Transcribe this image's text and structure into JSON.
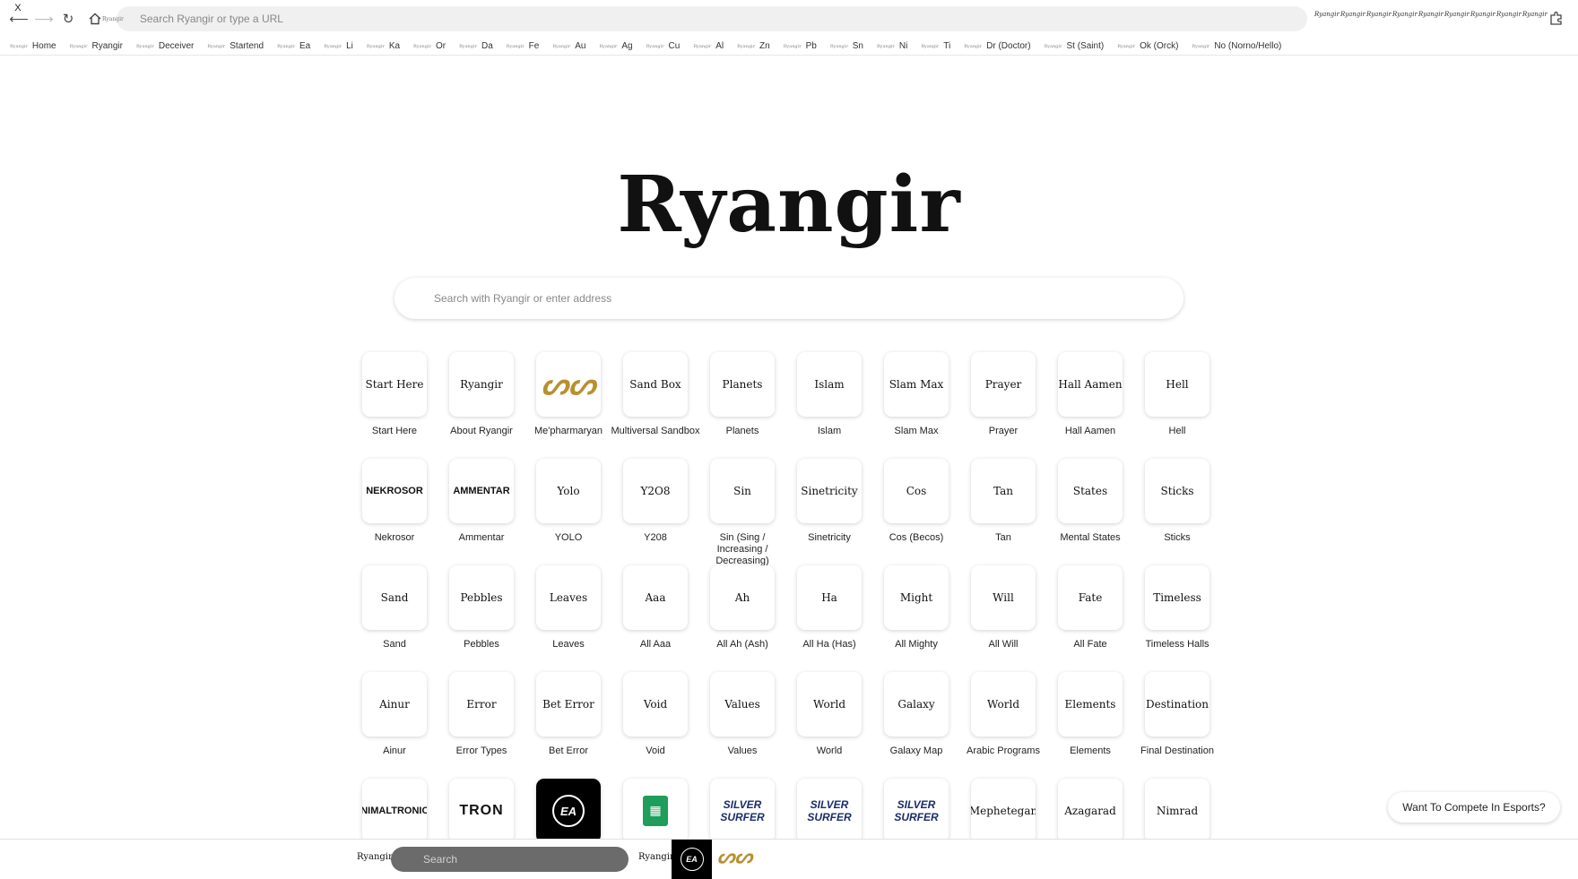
{
  "toolbar": {
    "close_label": "X",
    "back_icon": "back-arrow-icon",
    "forward_icon": "forward-arrow-icon",
    "reload_icon": "reload-icon",
    "home_icon": "home-icon",
    "address_placeholder": "Search Ryangir or type a URL",
    "address_favicon": "Ryangir",
    "extensions": [
      "Ryangir",
      "Ryangir",
      "Ryangir",
      "Ryangir",
      "Ryangir",
      "Ryangir",
      "Ryangir",
      "Ryangir",
      "Ryangir"
    ]
  },
  "bookmarks": [
    "Home",
    "Ryangir",
    "Deceiver",
    "Startend",
    "Ea",
    "Li",
    "Ka",
    "Or",
    "Da",
    "Fe",
    "Au",
    "Ag",
    "Cu",
    "Al",
    "Zn",
    "Pb",
    "Sn",
    "Ni",
    "Ti",
    "Dr (Doctor)",
    "St (Saint)",
    "Ok (Orck)",
    "No (Norno/Hello)"
  ],
  "bookmark_favicon": "Ryangir",
  "logo": {
    "text": "Ryangir"
  },
  "search": {
    "placeholder": "Search with Ryangir or enter address"
  },
  "tiles": [
    {
      "icon": "Start Here",
      "label": "Start Here",
      "style": ""
    },
    {
      "icon": "Ryangir",
      "label": "About Ryangir",
      "style": ""
    },
    {
      "icon": "ᔕᔕ",
      "label": "Me'pharmaryan",
      "style": "gold"
    },
    {
      "icon": "Sand Box",
      "label": "Multiversal Sandbox",
      "style": ""
    },
    {
      "icon": "Planets",
      "label": "Planets",
      "style": ""
    },
    {
      "icon": "Islam",
      "label": "Islam",
      "style": ""
    },
    {
      "icon": "Slam Max",
      "label": "Slam Max",
      "style": ""
    },
    {
      "icon": "Prayer",
      "label": "Prayer",
      "style": ""
    },
    {
      "icon": "Hall Aamen",
      "label": "Hall Aamen",
      "style": ""
    },
    {
      "icon": "Hell",
      "label": "Hell",
      "style": ""
    },
    {
      "icon": "NEKROSOR",
      "label": "Nekrosor",
      "style": "bold"
    },
    {
      "icon": "AMMENTAR",
      "label": "Ammentar",
      "style": "bold"
    },
    {
      "icon": "Yolo",
      "label": "YOLO",
      "style": ""
    },
    {
      "icon": "Y2O8",
      "label": "Y208",
      "style": ""
    },
    {
      "icon": "Sin",
      "label": "Sin (Sing / Increasing / Decreasing)",
      "style": ""
    },
    {
      "icon": "Sinetricity",
      "label": "Sinetricity",
      "style": ""
    },
    {
      "icon": "Cos",
      "label": "Cos (Becos)",
      "style": ""
    },
    {
      "icon": "Tan",
      "label": "Tan",
      "style": ""
    },
    {
      "icon": "States",
      "label": "Mental States",
      "style": ""
    },
    {
      "icon": "Sticks",
      "label": "Sticks",
      "style": ""
    },
    {
      "icon": "Sand",
      "label": "Sand",
      "style": ""
    },
    {
      "icon": "Pebbles",
      "label": "Pebbles",
      "style": ""
    },
    {
      "icon": "Leaves",
      "label": "Leaves",
      "style": ""
    },
    {
      "icon": "Aaa",
      "label": "All Aaa",
      "style": ""
    },
    {
      "icon": "Ah",
      "label": "All Ah (Ash)",
      "style": ""
    },
    {
      "icon": "Ha",
      "label": "All Ha (Has)",
      "style": ""
    },
    {
      "icon": "Might",
      "label": "All Mighty",
      "style": ""
    },
    {
      "icon": "Will",
      "label": "All Will",
      "style": ""
    },
    {
      "icon": "Fate",
      "label": "All Fate",
      "style": ""
    },
    {
      "icon": "Timeless",
      "label": "Timeless Halls",
      "style": ""
    },
    {
      "icon": "Ainur",
      "label": "Ainur",
      "style": ""
    },
    {
      "icon": "Error",
      "label": "Error Types",
      "style": ""
    },
    {
      "icon": "Bet Error",
      "label": "Bet Error",
      "style": ""
    },
    {
      "icon": "Void",
      "label": "Void",
      "style": ""
    },
    {
      "icon": "Values",
      "label": "Values",
      "style": ""
    },
    {
      "icon": "World",
      "label": "World",
      "style": ""
    },
    {
      "icon": "Galaxy",
      "label": "Galaxy Map",
      "style": ""
    },
    {
      "icon": "World",
      "label": "Arabic Programs",
      "style": ""
    },
    {
      "icon": "Elements",
      "label": "Elements",
      "style": ""
    },
    {
      "icon": "Destination",
      "label": "Final Destination",
      "style": ""
    },
    {
      "icon": "ANIMALTRONICS",
      "label": "",
      "style": "bold"
    },
    {
      "icon": "TRON",
      "label": "",
      "style": "tron"
    },
    {
      "icon": "EA",
      "label": "",
      "style": "black"
    },
    {
      "icon": "▦",
      "label": "",
      "style": "sheets"
    },
    {
      "icon": "SILVER SURFER",
      "label": "",
      "style": "surfer"
    },
    {
      "icon": "SILVER SURFER",
      "label": "",
      "style": "surfer"
    },
    {
      "icon": "SILVER SURFER",
      "label": "",
      "style": "surfer"
    },
    {
      "icon": "Mephetegan",
      "label": "",
      "style": ""
    },
    {
      "icon": "Azagarad",
      "label": "",
      "style": ""
    },
    {
      "icon": "Nimrad",
      "label": "",
      "style": ""
    }
  ],
  "esports_button": "Want To Compete In Esports?",
  "bottom_bar": {
    "left_label": "Ryangir",
    "search_placeholder": "Search",
    "right_label": "Ryangir",
    "ea_logo": "EA",
    "gold_logo": "ᔕᔕ"
  },
  "colors": {
    "gold": "#b8902f",
    "sheets_green": "#1e9e5a",
    "surfer_navy": "#1a2e6b"
  }
}
